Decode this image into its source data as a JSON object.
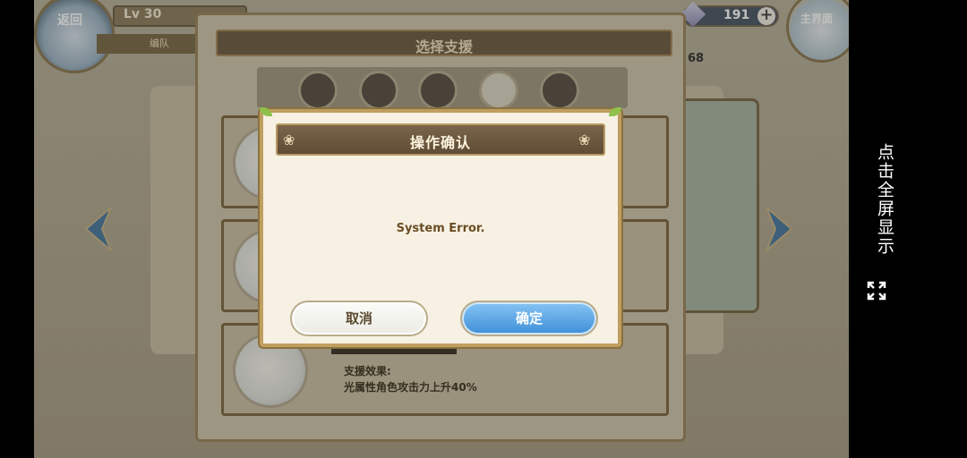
{
  "hud": {
    "back_label": "返回",
    "level": "Lv 30",
    "team_tab": "编队",
    "currency_value": "191",
    "home_label": "主界面",
    "count": "68"
  },
  "support_dialog": {
    "title": "选择支援",
    "elements": [
      "fire-icon",
      "wind-icon",
      "water-icon",
      "light-icon",
      "dark-icon"
    ],
    "rows": [
      {
        "label": ""
      },
      {
        "label": ""
      },
      {
        "label_effect": "支援效果:",
        "label_desc": "光属性角色攻击力上升40%"
      }
    ],
    "page_dots": 5,
    "active_dot": 1
  },
  "confirm_dialog": {
    "title": "操作确认",
    "message": "System Error.",
    "cancel_label": "取消",
    "ok_label": "确定"
  },
  "side_rail": {
    "fullscreen_label": "点击全屏显示"
  },
  "colors": {
    "title_bar": "#6f5f46",
    "ok_button": "#3e8fd8",
    "message_text": "#6b4d25"
  }
}
